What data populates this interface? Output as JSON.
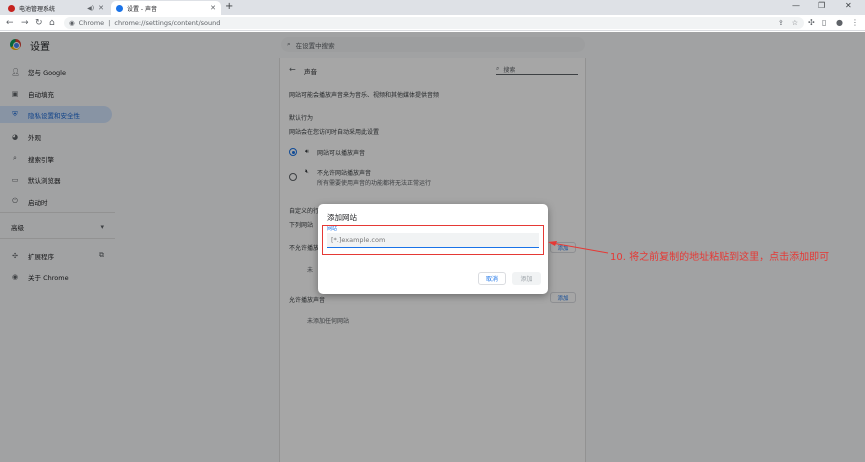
{
  "browser": {
    "tabs": [
      {
        "title": "电池管理系统",
        "active": false,
        "favicon_color": "#c5221f"
      },
      {
        "title": "设置 - 声音",
        "active": true,
        "favicon_color": "#1a73e8"
      }
    ],
    "new_tab_icon": "+",
    "window_controls": [
      "minimize-icon",
      "restore-icon",
      "close-icon"
    ],
    "omnibox": {
      "chip": "Chrome",
      "url": "chrome://settings/content/sound"
    }
  },
  "settings": {
    "app_title": "设置",
    "search_placeholder": "在设置中搜索",
    "sidebar": {
      "items": [
        {
          "label": "您与 Google",
          "icon": "person-icon"
        },
        {
          "label": "自动填充",
          "icon": "autofill-icon"
        },
        {
          "label": "隐私设置和安全性",
          "icon": "shield-icon",
          "active": true
        },
        {
          "label": "外观",
          "icon": "palette-icon"
        },
        {
          "label": "搜索引擎",
          "icon": "search-icon"
        },
        {
          "label": "默认浏览器",
          "icon": "browser-icon"
        },
        {
          "label": "启动时",
          "icon": "power-icon"
        }
      ],
      "advanced_label": "高级",
      "extensions_label": "扩展程序",
      "about_label": "关于 Chrome"
    },
    "sound_page": {
      "title": "声音",
      "search_label": "搜索",
      "description": "网站可能会播放声音来为音乐、视频和其他媒体提供音频",
      "default_behavior_heading": "默认行为",
      "default_behavior_desc": "网站会在您访问时自动采用此设置",
      "option_allow": "网站可以播放声音",
      "option_block": "不允许网站播放声音",
      "option_block_desc": "所有需要使用声音的功能都将无法正常运行",
      "custom_heading": "自定义的行为",
      "custom_desc": "下列网站",
      "not_allowed_heading": "不允许播放",
      "not_allowed_empty": "未",
      "allowed_heading": "允许播放声音",
      "allowed_empty": "未添加任何网站",
      "add_label": "添加"
    }
  },
  "dialog": {
    "title": "添加网站",
    "field_label": "网站",
    "field_placeholder": "[*.]example.com",
    "cancel_label": "取消",
    "add_label": "添加"
  },
  "annotation": {
    "text": "10. 将之前复制的地址粘贴到这里，点击添加即可",
    "color": "#e53935"
  }
}
